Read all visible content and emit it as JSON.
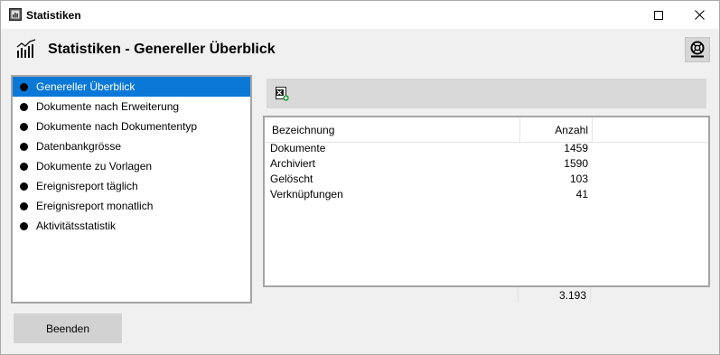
{
  "window": {
    "title": "Statistiken"
  },
  "header": {
    "title": "Statistiken - Genereller Überblick"
  },
  "nav": {
    "items": [
      {
        "label": "Genereller Überblick",
        "selected": true
      },
      {
        "label": "Dokumente nach Erweiterung"
      },
      {
        "label": "Dokumente nach Dokumententyp"
      },
      {
        "label": "Datenbankgrösse"
      },
      {
        "label": "Dokumente zu Vorlagen"
      },
      {
        "label": "Ereignisreport täglich"
      },
      {
        "label": "Ereignisreport monatlich"
      },
      {
        "label": "Aktivitätsstatistik"
      }
    ]
  },
  "table": {
    "columns": [
      "Bezeichnung",
      "Anzahl"
    ],
    "rows": [
      {
        "name": "Dokumente",
        "count": "1459"
      },
      {
        "name": "Archiviert",
        "count": "1590"
      },
      {
        "name": "Gelöscht",
        "count": "103"
      },
      {
        "name": "Verknüpfungen",
        "count": "41"
      }
    ],
    "total": "3.193"
  },
  "buttons": {
    "close_label": "Beenden"
  },
  "colors": {
    "selection": "#0a78d7",
    "toolbar": "#d9d9d9",
    "button": "#d2d2d2"
  },
  "icons": {
    "app": "statistics-window-icon",
    "header": "bar-chart-icon",
    "help": "lifebuoy-icon",
    "export": "export-excel-icon"
  }
}
